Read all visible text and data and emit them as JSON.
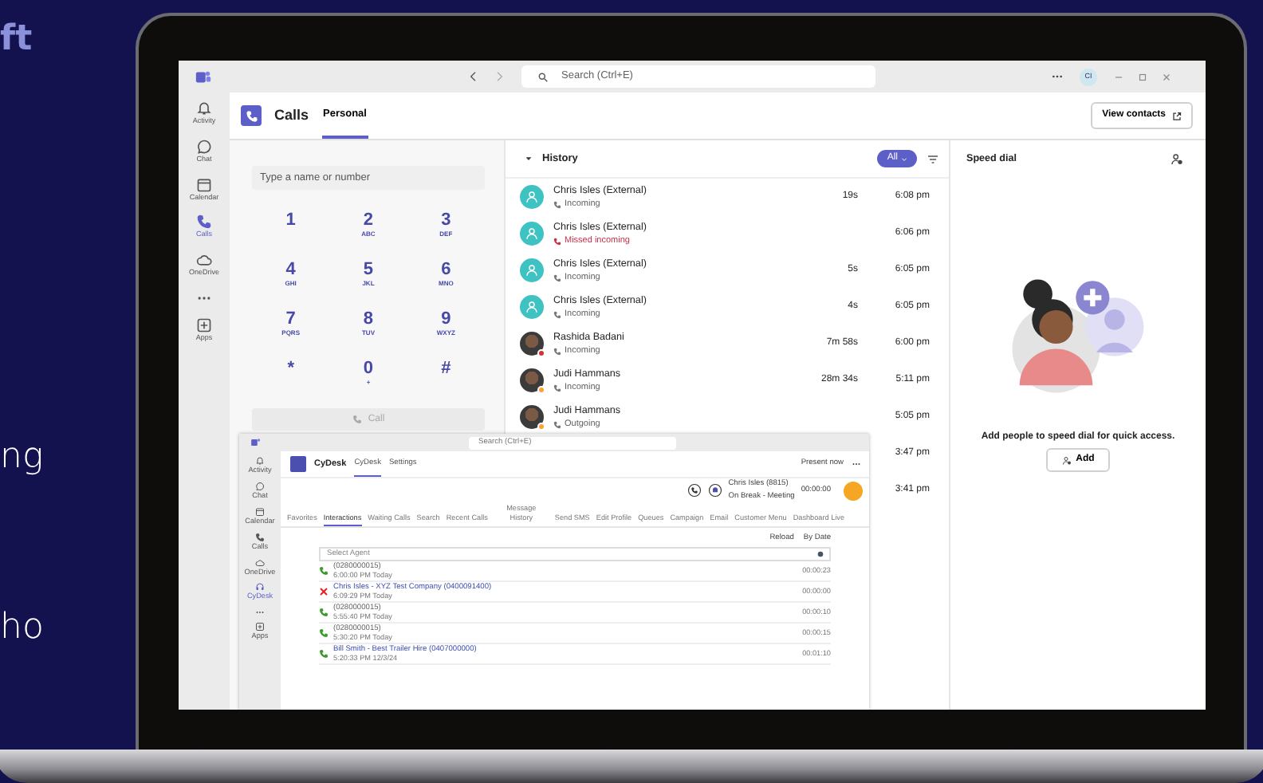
{
  "backdrop": {
    "text_fragments": [
      "ft",
      "ng",
      "ho"
    ]
  },
  "titlebar": {
    "search_placeholder": "Search (Ctrl+E)",
    "avatar_initials": "CI"
  },
  "rail": [
    {
      "kind": "app",
      "label": "Activity",
      "selected": false
    },
    {
      "kind": "app",
      "label": "Chat",
      "selected": false
    },
    {
      "kind": "app",
      "label": "Calendar",
      "selected": false
    },
    {
      "kind": "app",
      "label": "Calls",
      "selected": true
    },
    {
      "kind": "app",
      "label": "OneDrive",
      "selected": false
    },
    {
      "kind": "more",
      "selected": false
    },
    {
      "kind": "app",
      "label": "Apps",
      "selected": false
    }
  ],
  "calls_header": {
    "title": "Calls",
    "tabs": [
      {
        "label": "Personal",
        "selected": true
      }
    ],
    "view_contacts": "View contacts"
  },
  "dialpad": {
    "placeholder": "Type a name or number",
    "keys": [
      {
        "digit": "1"
      },
      {
        "digit": "2",
        "letters": "ABC"
      },
      {
        "digit": "3",
        "letters": "DEF"
      },
      {
        "digit": "4",
        "letters": "GHI"
      },
      {
        "digit": "5",
        "letters": "JKL"
      },
      {
        "digit": "6",
        "letters": "MNO"
      },
      {
        "digit": "7",
        "letters": "PQRS"
      },
      {
        "digit": "8",
        "letters": "TUV"
      },
      {
        "digit": "9",
        "letters": "WXYZ"
      },
      {
        "digit": "*"
      },
      {
        "digit": "0",
        "letters": "+"
      },
      {
        "digit": "#"
      }
    ],
    "call_button": {
      "label": "Call",
      "disabled": true
    }
  },
  "history": {
    "title": "History",
    "expanded": true,
    "filter": "All",
    "rows": [
      {
        "kind": "generic",
        "name": "Chris Isles (External)",
        "status": "Incoming",
        "missed": false,
        "duration": "19s",
        "time": "6:08 pm"
      },
      {
        "kind": "generic",
        "name": "Chris Isles (External)",
        "status": "Missed incoming",
        "missed": true,
        "time": "6:06 pm"
      },
      {
        "kind": "generic",
        "name": "Chris Isles (External)",
        "status": "Incoming",
        "missed": false,
        "duration": "5s",
        "time": "6:05 pm"
      },
      {
        "kind": "generic",
        "name": "Chris Isles (External)",
        "status": "Incoming",
        "missed": false,
        "duration": "4s",
        "time": "6:05 pm"
      },
      {
        "kind": "photo",
        "name": "Rashida Badani",
        "status": "Incoming",
        "missed": false,
        "duration": "7m 58s",
        "time": "6:00 pm",
        "color": "#d13438"
      },
      {
        "kind": "photo",
        "name": "Judi Hammans",
        "status": "Incoming",
        "missed": false,
        "duration": "28m 34s",
        "time": "5:11 pm",
        "color": "#f8a23a"
      },
      {
        "kind": "photo",
        "name": "Judi Hammans",
        "status": "Outgoing",
        "missed": false,
        "time": "5:05 pm",
        "color": "#f8a23a"
      },
      {
        "time": "3:47 pm"
      },
      {
        "time": "3:41 pm"
      }
    ]
  },
  "speed_dial": {
    "title": "Speed dial",
    "message": "Add people to speed dial for quick access.",
    "add_button": "Add"
  },
  "inset_window": {
    "search_placeholder": "Search (Ctrl+E)",
    "rail": [
      {
        "kind": "app",
        "label": "Activity",
        "selected": false
      },
      {
        "kind": "app",
        "label": "Chat",
        "selected": false
      },
      {
        "kind": "app",
        "label": "Calendar",
        "selected": false
      },
      {
        "kind": "app",
        "label": "Calls",
        "selected": false
      },
      {
        "kind": "app",
        "label": "OneDrive",
        "selected": false
      },
      {
        "kind": "app",
        "label": "CyDesk",
        "selected": true
      },
      {
        "kind": "more",
        "selected": false
      },
      {
        "kind": "app",
        "label": "Apps",
        "selected": false
      }
    ],
    "app_name": "CyDesk",
    "tabs": [
      {
        "label": "CyDesk",
        "selected": true
      },
      {
        "label": "Settings",
        "selected": false
      }
    ],
    "present_now": "Present now",
    "agent": {
      "name": "Chris Isles (8815)",
      "status": "On Break - Meeting",
      "timer": "00:00:00"
    },
    "nav_tabs": [
      {
        "label": "Favorites",
        "selected": false
      },
      {
        "label": "Interactions",
        "selected": true
      },
      {
        "label": "Waiting Calls",
        "selected": false
      },
      {
        "label": "Search",
        "selected": false
      },
      {
        "label": "Recent Calls",
        "selected": false
      },
      {
        "label": "Message History",
        "selected": false
      },
      {
        "label": "Send SMS",
        "selected": false
      },
      {
        "label": "Edit Profile",
        "selected": false
      },
      {
        "label": "Queues",
        "selected": false
      },
      {
        "label": "Campaign",
        "selected": false
      },
      {
        "label": "Email",
        "selected": false
      },
      {
        "label": "Customer Menu",
        "selected": false
      },
      {
        "label": "Dashboard Live",
        "selected": false
      }
    ],
    "reload": "Reload",
    "by_date": "By Date",
    "agent_placeholder": "Select Agent",
    "interactions": [
      {
        "kind": "answered",
        "caller": "(0280000015)",
        "when": "6:00:00 PM Today",
        "duration": "00:00:23"
      },
      {
        "kind": "missed",
        "caller": "Chris Isles - XYZ Test Company (0400091400)",
        "when": "6:09:29 PM Today",
        "duration": "00:00:00"
      },
      {
        "kind": "answered",
        "caller": "(0280000015)",
        "when": "5:55:40 PM Today",
        "duration": "00:00:10"
      },
      {
        "kind": "answered",
        "caller": "(0280000015)",
        "when": "5:30:20 PM Today",
        "duration": "00:00:15"
      },
      {
        "kind": "answered",
        "caller": "Bill Smith - Best Trailer Hire (0407000000)",
        "when": "5:20:33 PM 12/3/24",
        "duration": "00:01:10"
      }
    ]
  }
}
